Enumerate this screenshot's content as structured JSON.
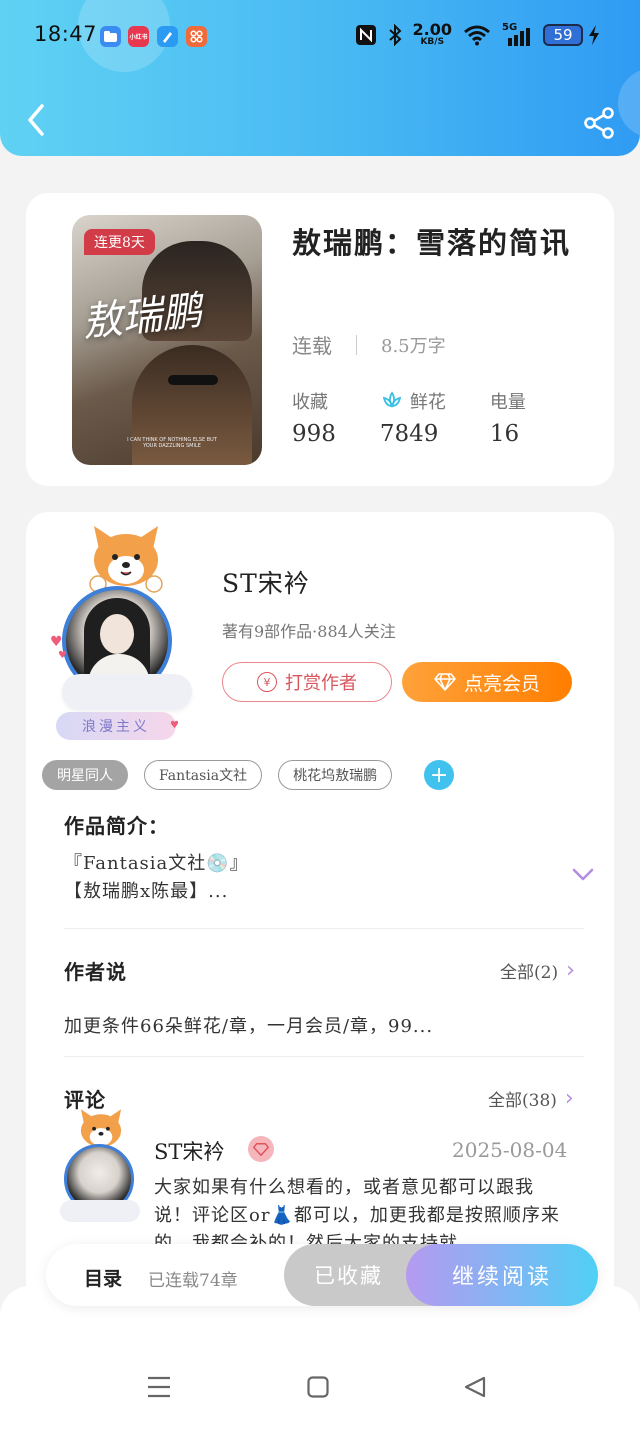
{
  "status_bar": {
    "time": "18:47",
    "speed_value": "2.00",
    "speed_unit": "KB/S",
    "network": "5G",
    "battery": "59",
    "app_icons": [
      {
        "name": "files-app-icon",
        "color": "#3b8cf2"
      },
      {
        "name": "xiaohongshu-app-icon",
        "color": "#e8384f",
        "label": "小红书"
      },
      {
        "name": "notes-app-icon",
        "color": "#2b9af3"
      },
      {
        "name": "grid-app-icon",
        "color": "#f06a3a"
      }
    ]
  },
  "header": {
    "back_icon": "chevron-left-icon",
    "share_icon": "share-icon"
  },
  "book": {
    "cover_badge": "连更8天",
    "cover_title": "敖瑞鹏",
    "cover_small": "I CAN THINK OF NOTHING ELSE BUT YOUR DAZZLING SMILE",
    "title": "敖瑞鹏：雪落的简讯",
    "status": "连载",
    "words": "8.5万字",
    "stats": [
      {
        "label": "收藏",
        "value": "998"
      },
      {
        "label": "鲜花",
        "value": "7849",
        "icon": "lotus-icon"
      },
      {
        "label": "电量",
        "value": "16"
      }
    ]
  },
  "author": {
    "name": "ST宋衿",
    "sub": "著有9部作品·884人关注",
    "avatar_tag": "浪漫主义",
    "tip_button": "打赏作者",
    "vip_button": "点亮会员",
    "tags": [
      "明星同人",
      "Fantasia文社",
      "桃花坞敖瑞鹏"
    ]
  },
  "intro": {
    "title": "作品简介：",
    "line1": "『Fantasia文社💿』",
    "line2": "【敖瑞鹏x陈最】..."
  },
  "author_say": {
    "title": "作者说",
    "all": "全部(2)",
    "text": "加更条件66朵鲜花/章，一月会员/章，99..."
  },
  "comments": {
    "title": "评论",
    "all": "全部(38)",
    "first": {
      "name": "ST宋衿",
      "date": "2025-08-04",
      "text": "大家如果有什么想看的，或者意见都可以跟我说！评论区or👗都可以，加更我都是按照顺序来的，我都会补的！然后大家的支持就"
    }
  },
  "read_bar": {
    "toc": "目录",
    "chapters": "已连载74章",
    "fav": "已收藏",
    "read": "继续阅读"
  },
  "colors": {
    "header_start": "#5fd2f3",
    "header_end": "#2f9bf3",
    "accent_orange": "#ff8a14",
    "accent_pink": "#d8575f",
    "accent_blue": "#41c2ee"
  }
}
